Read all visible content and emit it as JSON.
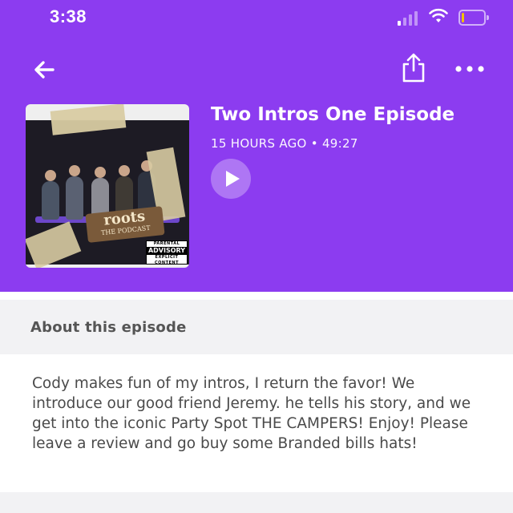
{
  "status_bar": {
    "time": "3:38",
    "signal_bars": 1,
    "battery_level": 0.15
  },
  "nav": {
    "back_icon": "arrow-left-icon",
    "share_icon": "share-icon",
    "more_icon": "more-horizontal-icon"
  },
  "episode": {
    "title": "Two Intros One Episode",
    "meta": "15 HOURS AGO • 49:27",
    "play_icon": "play-icon",
    "artwork": {
      "logo_title": "roots",
      "logo_subtitle": "THE PODCAST",
      "advisory_top": "PARENTAL",
      "advisory_middle": "ADVISORY",
      "advisory_bottom": "EXPLICIT CONTENT"
    }
  },
  "about": {
    "heading": "About this episode",
    "description": "Cody makes fun of my intros, I return the favor! We introduce our good friend Jeremy. he tells his story, and we get into the iconic Party Spot THE CAMPERS! Enjoy! Please leave a review and go buy some Branded bills hats!"
  },
  "colors": {
    "header_bg": "#8c3cf0",
    "section_bg": "#f2f2f4",
    "text": "#4a4a4a"
  }
}
